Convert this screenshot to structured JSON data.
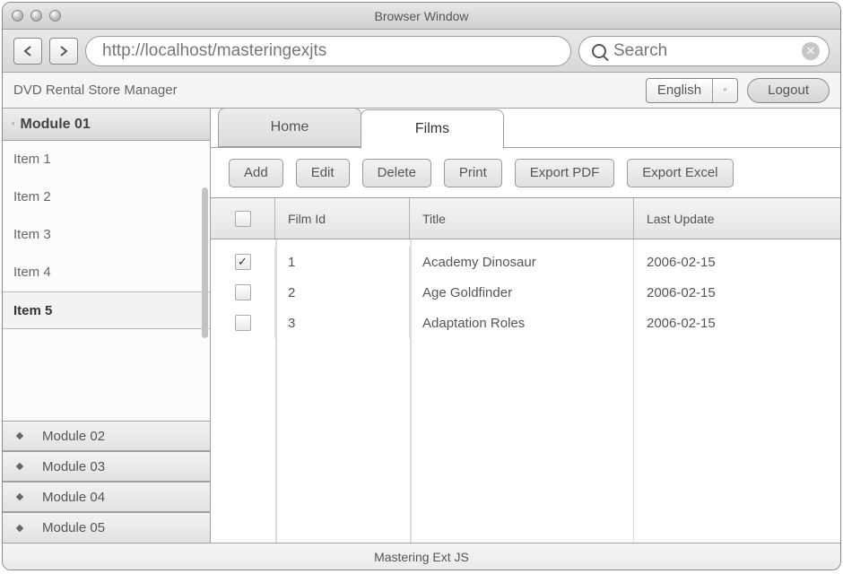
{
  "window": {
    "title": "Browser Window"
  },
  "browser": {
    "url": "http://localhost/masteringexjts",
    "search_placeholder": "Search"
  },
  "app": {
    "title": "DVD Rental Store Manager",
    "language": "English",
    "logout_label": "Logout",
    "footer": "Mastering Ext JS"
  },
  "sidebar": {
    "expanded": {
      "title": "Module 01",
      "items": [
        "Item 1",
        "Item 2",
        "Item 3",
        "Item 4",
        "Item 5"
      ],
      "selected_index": 4
    },
    "collapsed": [
      "Module 02",
      "Module 03",
      "Module 04",
      "Module 05"
    ]
  },
  "tabs": {
    "items": [
      "Home",
      "Films"
    ],
    "active_index": 1
  },
  "toolbar": {
    "add": "Add",
    "edit": "Edit",
    "delete": "Delete",
    "print": "Print",
    "export_pdf": "Export PDF",
    "export_excel": "Export Excel"
  },
  "grid": {
    "columns": {
      "film_id": "Film Id",
      "title": "Title",
      "last_update": "Last Update"
    },
    "rows": [
      {
        "checked": true,
        "film_id": "1",
        "title": "Academy Dinosaur",
        "last_update": "2006-02-15"
      },
      {
        "checked": false,
        "film_id": "2",
        "title": "Age Goldfinder",
        "last_update": "2006-02-15"
      },
      {
        "checked": false,
        "film_id": "3",
        "title": "Adaptation Roles",
        "last_update": "2006-02-15"
      }
    ]
  }
}
